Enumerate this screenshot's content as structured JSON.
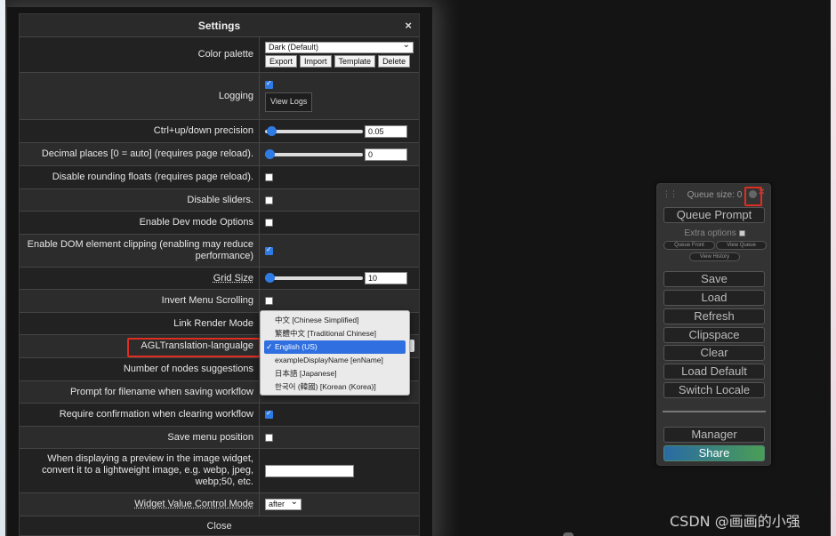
{
  "dialog": {
    "title": "Settings",
    "close_glyph": "×",
    "palette": {
      "label": "Color palette",
      "value": "Dark (Default)",
      "buttons": [
        "Export",
        "Import",
        "Template",
        "Delete"
      ]
    },
    "logging": {
      "label": "Logging",
      "checked": true,
      "button": "View Logs"
    },
    "precision": {
      "label": "Ctrl+up/down precision",
      "value": "0.05"
    },
    "decimal": {
      "label": "Decimal places [0 = auto] (requires page reload).",
      "value": "0"
    },
    "rounding": {
      "label": "Disable rounding floats (requires page reload).",
      "checked": false
    },
    "sliders": {
      "label": "Disable sliders.",
      "checked": false
    },
    "devmode": {
      "label": "Enable Dev mode Options",
      "checked": false
    },
    "domclip": {
      "label": "Enable DOM element clipping (enabling may reduce performance)",
      "checked": true
    },
    "grid": {
      "label": "Grid Size",
      "value": "10"
    },
    "invert": {
      "label": "Invert Menu Scrolling",
      "checked": false
    },
    "linkrender": {
      "label": "Link Render Mode"
    },
    "language": {
      "label": "AGLTranslation-langualge"
    },
    "nodes": {
      "label": "Number of nodes suggestions"
    },
    "prompt": {
      "label": "Prompt for filename when saving workflow"
    },
    "confirm": {
      "label": "Require confirmation when clearing workflow",
      "checked": true
    },
    "savemenu": {
      "label": "Save menu position",
      "checked": false
    },
    "preview": {
      "label": "When displaying a preview in the image widget, convert it to a lightweight image, e.g. webp, jpeg, webp;50, etc.",
      "value": ""
    },
    "widget": {
      "label": "Widget Value Control Mode",
      "value": "after"
    },
    "close_label": "Close"
  },
  "language_menu": {
    "options": [
      "中文 [Chinese Simplified]",
      "繁體中文 [Traditional Chinese]",
      "English (US)",
      "exampleDisplayName [enName]",
      "日本語 [Japanese]",
      "한국어 (韓國) [Korean (Korea)]"
    ],
    "selected": "English (US)"
  },
  "queue_panel": {
    "queue_size": "Queue size: 0",
    "queue_prompt": "Queue Prompt",
    "extra_options": "Extra options",
    "queue_front": "Queue Front",
    "view_queue": "View Queue",
    "view_history": "View History",
    "buttons": [
      "Save",
      "Load",
      "Refresh",
      "Clipspace",
      "Clear",
      "Load Default",
      "Switch Locale"
    ],
    "manager": "Manager",
    "share": "Share"
  },
  "watermark": "CSDN @画画的小强"
}
